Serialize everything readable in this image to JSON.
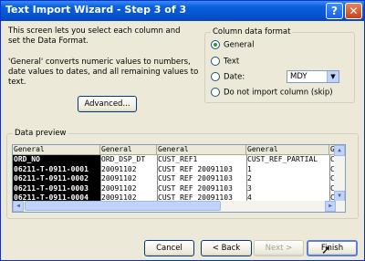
{
  "window": {
    "title": "Text Import Wizard - Step 3 of 3"
  },
  "intro_text": "This screen lets you select each column and set the Data Format.",
  "intro_text2": "'General' converts numeric values to numbers, date values to dates, and all remaining values to text.",
  "advanced_button": "Advanced...",
  "column_format": {
    "legend": "Column data format",
    "options": {
      "general": "General",
      "text": "Text",
      "date": "Date:",
      "skip": "Do not import column (skip)"
    },
    "selected": "General",
    "date_value": "MDY"
  },
  "preview": {
    "legend": "Data preview",
    "headers": [
      "General",
      "General",
      "General",
      "General",
      "Ge"
    ],
    "rows": [
      [
        "ORD_NO",
        "ORD_DSP_DT",
        "CUST_REF1",
        "CUST_REF_PARTIAL",
        "CU"
      ],
      [
        "06211-T-0911-0001",
        "20091102",
        "CUST REF 20091103",
        "1",
        "CU"
      ],
      [
        "06211-T-0911-0002",
        "20091102",
        "CUST REF 20091103",
        "2",
        "CU"
      ],
      [
        "06211-T-0911-0003",
        "20091102",
        "CUST REF 20091103",
        "3",
        "CU"
      ],
      [
        "06211-T-0911-0004",
        "20091102",
        "CUST REF 20091103",
        "4",
        "CU"
      ]
    ]
  },
  "buttons": {
    "cancel": "Cancel",
    "back": "< Back",
    "next": "Next >",
    "finish": "Finish"
  },
  "colors": {
    "titlebar": "#0a5fdc",
    "selected_column": "#000000",
    "dialog_bg": "#ece9d8"
  }
}
